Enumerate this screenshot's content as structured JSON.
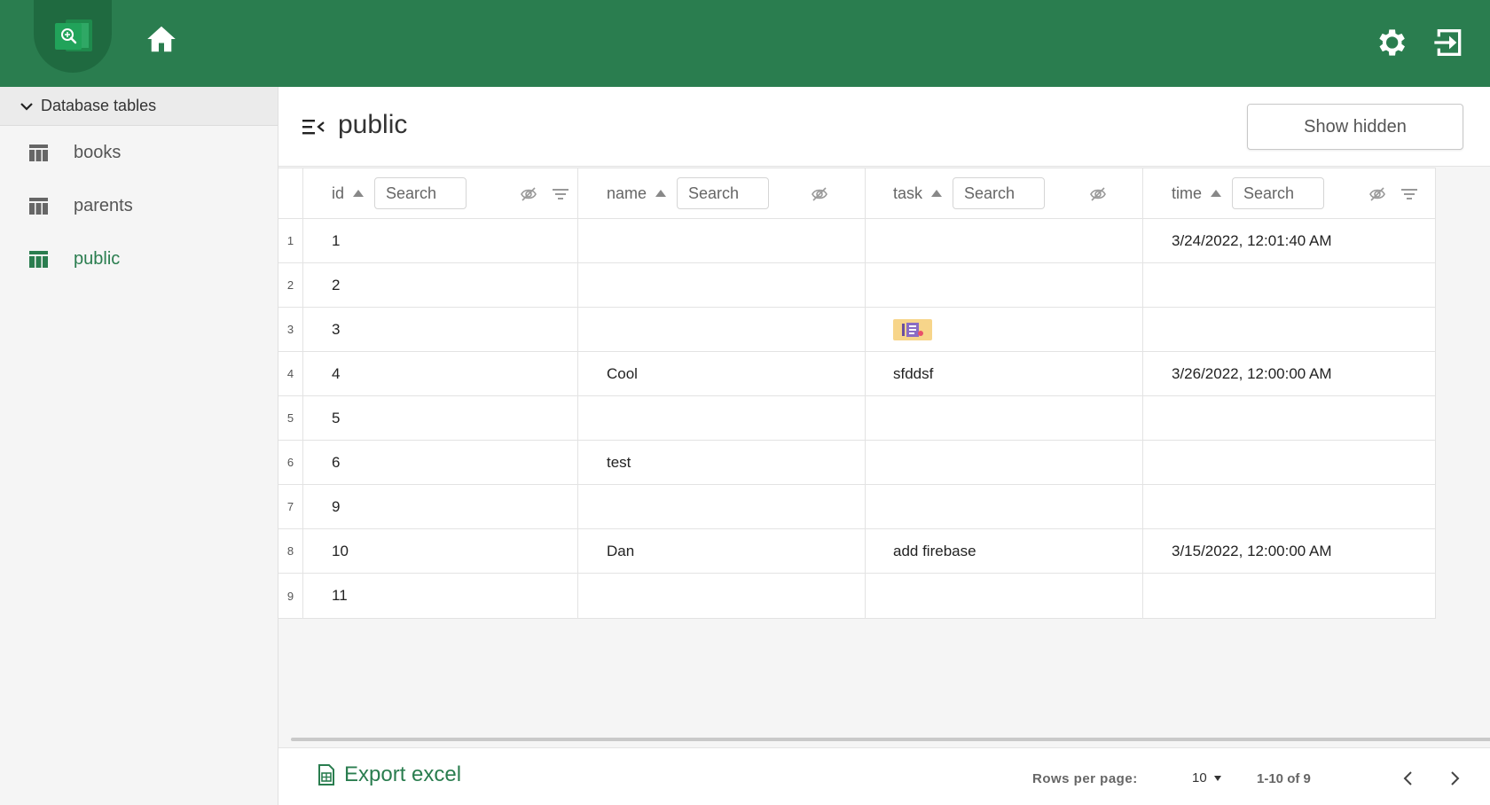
{
  "sidebar": {
    "header": "Database tables",
    "items": [
      {
        "label": "books"
      },
      {
        "label": "parents"
      },
      {
        "label": "public"
      }
    ]
  },
  "main": {
    "title": "public",
    "show_hidden_label": "Show hidden"
  },
  "table": {
    "columns": [
      {
        "label": "id",
        "search_placeholder": "Search"
      },
      {
        "label": "name",
        "search_placeholder": "Search"
      },
      {
        "label": "task",
        "search_placeholder": "Search"
      },
      {
        "label": "time",
        "search_placeholder": "Search"
      }
    ],
    "rows": [
      {
        "num": "1",
        "id": "1",
        "name": "",
        "task": "",
        "time": "3/24/2022, 12:01:40 AM"
      },
      {
        "num": "2",
        "id": "2",
        "name": "",
        "task": "",
        "time": ""
      },
      {
        "num": "3",
        "id": "3",
        "name": "",
        "task": "",
        "time": ""
      },
      {
        "num": "4",
        "id": "4",
        "name": "Cool",
        "task": "sfddsf",
        "time": "3/26/2022, 12:00:00 AM"
      },
      {
        "num": "5",
        "id": "5",
        "name": "",
        "task": "",
        "time": ""
      },
      {
        "num": "6",
        "id": "6",
        "name": "test",
        "task": "",
        "time": ""
      },
      {
        "num": "7",
        "id": "9",
        "name": "",
        "task": "",
        "time": ""
      },
      {
        "num": "8",
        "id": "10",
        "name": "Dan",
        "task": "add firebase",
        "time": "3/15/2022, 12:00:00 AM"
      },
      {
        "num": "9",
        "id": "11",
        "name": "",
        "task": "",
        "time": ""
      }
    ]
  },
  "footer": {
    "export_label": "Export excel",
    "rows_per_page_label": "Rows per page:",
    "rows_per_page_value": "10",
    "page_info": "1-10 of 9"
  },
  "colors": {
    "brand": "#2a7d4f",
    "brand_dark": "#1f6a40",
    "thumbnail": "#f7d58a"
  },
  "icons": [
    "app-logo-icon",
    "home-icon",
    "gear-icon",
    "logout-icon",
    "chevron-down-icon",
    "table-icon",
    "menu-collapse-icon",
    "eye-off-icon",
    "filter-icon",
    "excel-icon",
    "chevron-left-icon",
    "chevron-right-icon"
  ]
}
